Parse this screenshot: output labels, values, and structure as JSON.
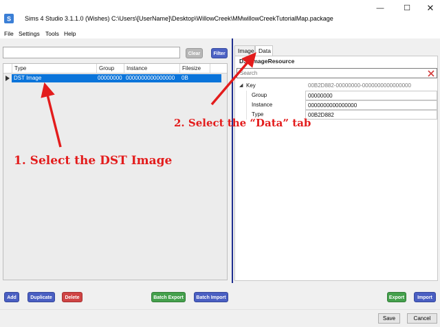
{
  "window": {
    "title": "Sims 4 Studio 3.1.1.0 (Wishes)   C:\\Users\\[UserName]\\Desktop\\WillowCreek\\MMwillowCreekTutorialMap.package",
    "min_glyph": "—",
    "max_glyph": "☐",
    "close_glyph": "✕"
  },
  "menu": [
    "File",
    "Settings",
    "Tools",
    "Help"
  ],
  "left": {
    "search": {
      "value": "",
      "placeholder": ""
    },
    "clear_label": "Clear",
    "filter_label": "Filter",
    "columns": [
      "Type",
      "Group",
      "Instance",
      "Filesize"
    ],
    "rows": [
      {
        "type": "DST Image",
        "group": "00000000",
        "instance": "0000000000000000",
        "filesize": "0B",
        "selected": true
      }
    ]
  },
  "right": {
    "tabs": [
      "Image",
      "Data"
    ],
    "active_tab": "Data",
    "resource_title": "DSTImageResource",
    "prop_search_placeholder": "Search",
    "properties": {
      "key_label": "Key",
      "key_value": "00B2D882-00000000-0000000000000000",
      "group_label": "Group",
      "group_value": "00000000",
      "instance_label": "Instance",
      "instance_value": "0000000000000000",
      "type_label": "Type",
      "type_value": "00B2D882"
    }
  },
  "bottom": {
    "add": "Add",
    "duplicate": "Duplicate",
    "delete": "Delete",
    "batch_export": "Batch Export",
    "batch_import": "Batch Import",
    "export": "Export",
    "import": "Import",
    "save": "Save",
    "cancel": "Cancel"
  },
  "annotations": {
    "step1": "1. Select the DST Image",
    "step2": "2. Select the “Data” tab",
    "color": "#e31c1c"
  },
  "colors": {
    "selection": "#0a74da",
    "button_blue": "#4a5fc2",
    "button_red": "#cf4444",
    "button_green": "#44a04c",
    "splitter": "#1f2f8f"
  }
}
